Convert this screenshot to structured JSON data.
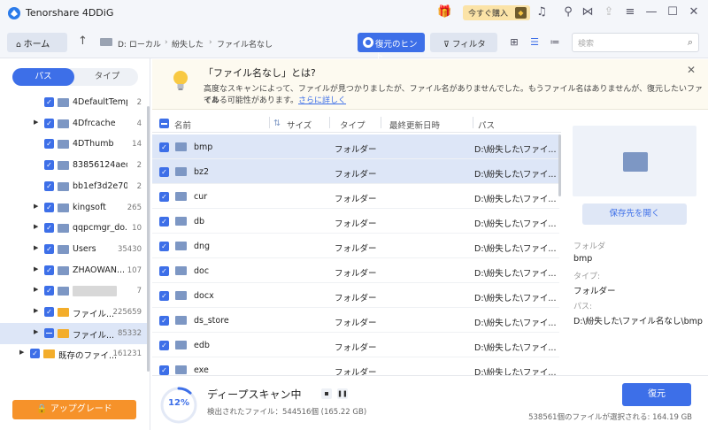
{
  "app": {
    "title": "Tenorshare 4DDiG"
  },
  "titlebar": {
    "buy_label": "今すぐ購入",
    "icons": [
      "gift-icon",
      "headset-icon",
      "share-icon",
      "export-icon",
      "menu-icon",
      "minimize-icon",
      "maximize-icon",
      "close-icon"
    ]
  },
  "nav": {
    "home_label": "ホーム",
    "breadcrumb": [
      "D: ローカル",
      "紛失した",
      "ファイル名なし"
    ],
    "hint_label": "復元のヒント",
    "filter_label": "フィルタ",
    "search_placeholder": "検索"
  },
  "sidebar": {
    "tab_path": "パス",
    "tab_type": "タイプ",
    "items": [
      {
        "name": "4DefaultTemp...",
        "count": "2"
      },
      {
        "name": "4Dfrcache",
        "count": "4"
      },
      {
        "name": "4DThumb",
        "count": "14"
      },
      {
        "name": "83856124aed...",
        "count": "2"
      },
      {
        "name": "bb1ef3d2e70c...",
        "count": "2"
      },
      {
        "name": "kingsoft",
        "count": "265"
      },
      {
        "name": "qqpcmgr_do...",
        "count": "10"
      },
      {
        "name": "Users",
        "count": "35430"
      },
      {
        "name": "ZHAOWAN...",
        "count": "107"
      },
      {
        "name": "",
        "count": "7"
      },
      {
        "name": "ファイル...",
        "count": "225659"
      },
      {
        "name": "ファイル...",
        "count": "85332"
      },
      {
        "name": "既存のファイ...",
        "count": "161231"
      }
    ],
    "upgrade_label": "アップグレード"
  },
  "banner": {
    "title": "「ファイル名なし」とは?",
    "text1": "高度なスキャンによって、ファイルが見つかりましたが、ファイル名がありませんでした。もうファイル名はありませんが、復元したいファイル",
    "text2": "である可能性があります。",
    "link": "さらに詳しく"
  },
  "table": {
    "headers": {
      "name": "名前",
      "size": "サイズ",
      "type": "タイプ",
      "modified": "最終更新日時",
      "path": "パス"
    },
    "rows": [
      {
        "name": "bmp",
        "type": "フォルダー",
        "path": "D:\\紛失した\\ファイ..."
      },
      {
        "name": "bz2",
        "type": "フォルダー",
        "path": "D:\\紛失した\\ファイ..."
      },
      {
        "name": "cur",
        "type": "フォルダー",
        "path": "D:\\紛失した\\ファイ..."
      },
      {
        "name": "db",
        "type": "フォルダー",
        "path": "D:\\紛失した\\ファイ..."
      },
      {
        "name": "dng",
        "type": "フォルダー",
        "path": "D:\\紛失した\\ファイ..."
      },
      {
        "name": "doc",
        "type": "フォルダー",
        "path": "D:\\紛失した\\ファイ..."
      },
      {
        "name": "docx",
        "type": "フォルダー",
        "path": "D:\\紛失した\\ファイ..."
      },
      {
        "name": "ds_store",
        "type": "フォルダー",
        "path": "D:\\紛失した\\ファイ..."
      },
      {
        "name": "edb",
        "type": "フォルダー",
        "path": "D:\\紛失した\\ファイ..."
      },
      {
        "name": "exe",
        "type": "フォルダー",
        "path": "D:\\紛失した\\ファイ..."
      }
    ]
  },
  "preview": {
    "open_label": "保存先を開く",
    "folder_label": "フォルダ",
    "folder_value": "bmp",
    "type_label": "タイプ:",
    "type_value": "フォルダー",
    "path_label": "パス:",
    "path_value": "D:\\紛失した\\ファイル名なし\\bmp"
  },
  "status": {
    "progress_label": "12%",
    "progress": 0.12,
    "scan_title": "ディープスキャン中",
    "scan_detail": "検出されたファイル：544516個 (165.22 GB)",
    "recover_label": "復元",
    "selected_info": "538561個のファイルが選択される:   164.19 GB"
  },
  "colors": {
    "accent": "#3d6fe8",
    "upgrade": "#f6922a",
    "folder": "#7d97c4"
  }
}
